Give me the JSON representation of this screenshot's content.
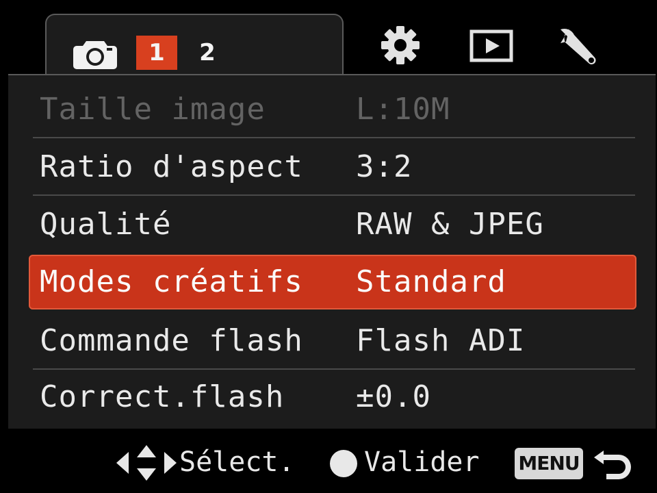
{
  "tabs": {
    "shooting": {
      "icon": "camera-icon",
      "pages": [
        "1",
        "2"
      ],
      "active_page": "1"
    },
    "others": [
      {
        "icon": "gear-icon"
      },
      {
        "icon": "playback-icon"
      },
      {
        "icon": "wrench-icon"
      }
    ]
  },
  "menu": {
    "rows": [
      {
        "label": "Taille image",
        "value": "L:10M",
        "state": "disabled"
      },
      {
        "label": "Ratio d'aspect",
        "value": "3:2",
        "state": "normal"
      },
      {
        "label": "Qualité",
        "value": "RAW & JPEG",
        "state": "normal"
      },
      {
        "label": "Modes créatifs",
        "value": "Standard",
        "state": "selected"
      },
      {
        "label": "Commande flash",
        "value": "Flash ADI",
        "state": "normal"
      },
      {
        "label": "Correct.flash",
        "value": "±0.0",
        "state": "normal"
      }
    ]
  },
  "footer": {
    "select_icon": "dpad-icon",
    "select_label": "Sélect.",
    "validate_icon": "center-button-icon",
    "validate_label": "Valider",
    "menu_button_label": "MENU",
    "back_icon": "return-arrow-icon"
  },
  "colors": {
    "accent": "#c9341a",
    "background": "#000000",
    "panel": "#1c1c1c",
    "text": "#e9e9e9",
    "disabled_text": "#636363"
  }
}
